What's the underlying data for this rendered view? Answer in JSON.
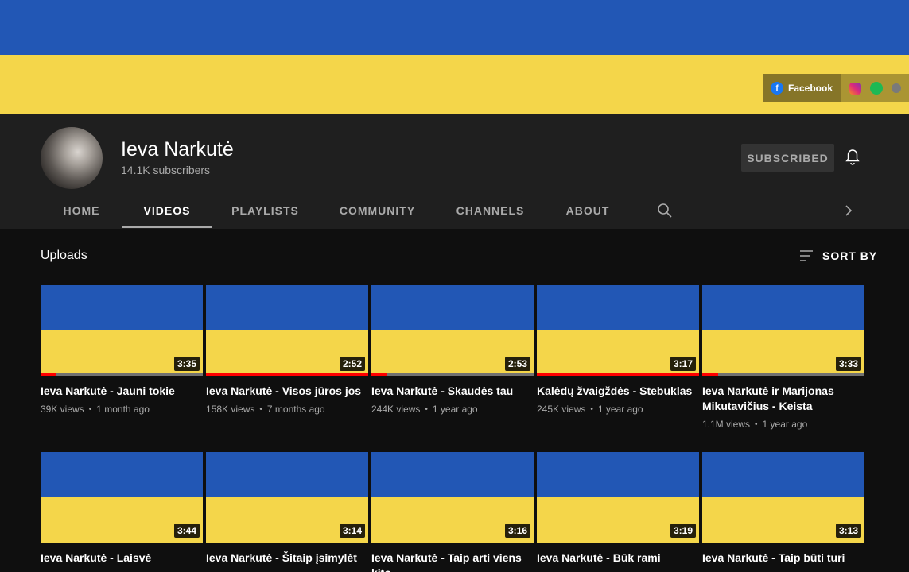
{
  "banner": {
    "colors": {
      "top": "#2257b5",
      "bottom": "#f4d64a"
    },
    "links": {
      "primary_label": "Facebook",
      "icons": [
        "facebook-icon",
        "instagram-icon",
        "spotify-icon",
        "link-icon"
      ]
    }
  },
  "channel": {
    "name": "Ieva Narkutė",
    "subscribers": "14.1K subscribers",
    "subscribe_button": "SUBSCRIBED"
  },
  "tabs": [
    {
      "label": "HOME",
      "active": false
    },
    {
      "label": "VIDEOS",
      "active": true
    },
    {
      "label": "PLAYLISTS",
      "active": false
    },
    {
      "label": "COMMUNITY",
      "active": false
    },
    {
      "label": "CHANNELS",
      "active": false
    },
    {
      "label": "ABOUT",
      "active": false
    }
  ],
  "uploads": {
    "title": "Uploads",
    "sort_label": "SORT BY"
  },
  "videos": [
    {
      "title": "Ieva Narkutė - Jauni tokie",
      "views": "39K views",
      "age": "1 month ago",
      "duration": "3:35",
      "watched": 0.1
    },
    {
      "title": "Ieva Narkutė - Visos jūros jos",
      "views": "158K views",
      "age": "7 months ago",
      "duration": "2:52",
      "watched": 1.0
    },
    {
      "title": "Ieva Narkutė - Skaudės tau",
      "views": "244K views",
      "age": "1 year ago",
      "duration": "2:53",
      "watched": 0.1
    },
    {
      "title": "Kalėdų žvaigždės - Stebuklas",
      "views": "245K views",
      "age": "1 year ago",
      "duration": "3:17",
      "watched": 1.0
    },
    {
      "title": "Ieva Narkutė ir Marijonas Mikutavičius - Keista",
      "views": "1.1M views",
      "age": "1 year ago",
      "duration": "3:33",
      "watched": 0.1
    },
    {
      "title": "Ieva Narkutė - Laisvė",
      "views": "",
      "age": "",
      "duration": "3:44",
      "watched": 0
    },
    {
      "title": "Ieva Narkutė - Šitaip įsimylėt",
      "views": "",
      "age": "",
      "duration": "3:14",
      "watched": 0
    },
    {
      "title": "Ieva Narkutė - Taip arti viens kito",
      "views": "",
      "age": "",
      "duration": "3:16",
      "watched": 0
    },
    {
      "title": "Ieva Narkutė - Būk rami",
      "views": "",
      "age": "",
      "duration": "3:19",
      "watched": 0
    },
    {
      "title": "Ieva Narkutė - Taip būti turi",
      "views": "",
      "age": "",
      "duration": "3:13",
      "watched": 0
    }
  ]
}
